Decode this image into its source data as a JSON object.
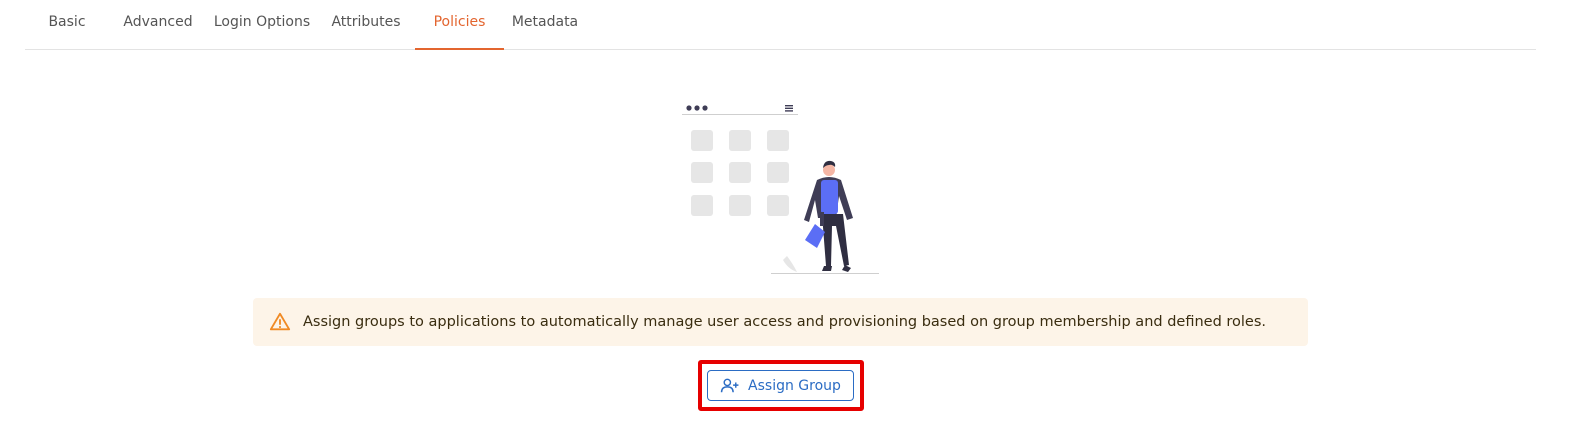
{
  "tabs": [
    {
      "label": "Basic",
      "active": false
    },
    {
      "label": "Advanced",
      "active": false
    },
    {
      "label": "Login Options",
      "active": false
    },
    {
      "label": "Attributes",
      "active": false
    },
    {
      "label": "Policies",
      "active": true
    },
    {
      "label": "Metadata",
      "active": false
    }
  ],
  "banner": {
    "icon": "warning-triangle-icon",
    "text": "Assign groups to applications to automatically manage user access and provisioning based on group membership and defined roles."
  },
  "assign_button": {
    "label": "Assign Group",
    "icon": "user-plus-icon"
  },
  "colors": {
    "accent_active_tab": "#e3652f",
    "button_primary": "#2b6cc4",
    "banner_bg": "#fdf4e8",
    "highlight": "#e60000"
  }
}
